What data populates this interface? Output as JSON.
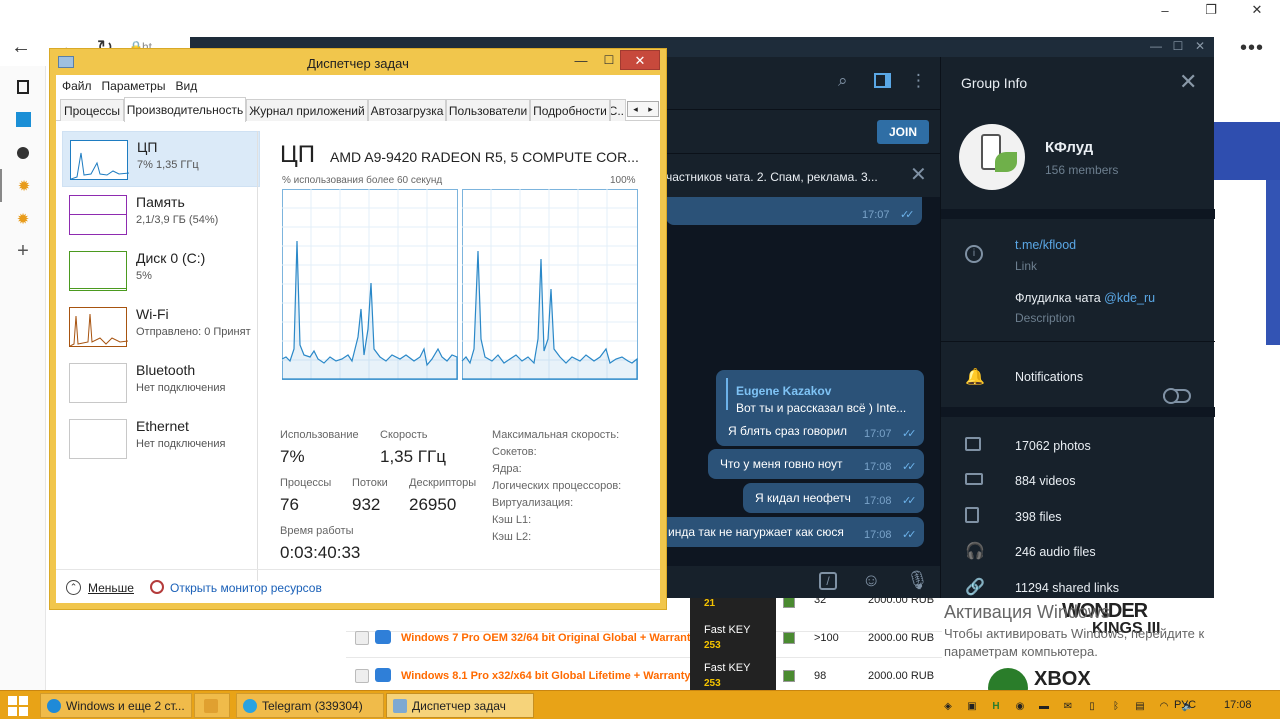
{
  "browser": {
    "tab_text": "ht",
    "window_controls": [
      "–",
      "❐",
      "✕"
    ],
    "more_icon": "•••"
  },
  "web_page": {
    "rows": [
      {
        "product": "",
        "seller": "",
        "seller_num": "21",
        "qty": "32",
        "price": "2000.00 RUB"
      },
      {
        "product": "Windows 7 Pro OEM 32/64 bit Original Global + Warranty",
        "seller": "Fast KEY",
        "seller_num": "253",
        "qty": ">100",
        "price": "2000.00 RUB"
      },
      {
        "product": "Windows 8.1 Pro x32/x64 bit Global Lifetime + Warranty",
        "seller": "Fast KEY",
        "seller_num": "253",
        "qty": "98",
        "price": "2000.00 RUB"
      }
    ],
    "game_banner_1": "WONDER",
    "game_banner_2": "KINGS III",
    "game_banner_3": "XBOX",
    "activation_title": "Активация Windows",
    "activation_text": "Чтобы активировать Windows, перейдите к параметрам компьютера."
  },
  "telegram": {
    "window_controls": [
      "—",
      "☐",
      "✕"
    ],
    "join_label": "JOIN",
    "pinned_text": "частников чата. 2. Спам, реклама. 3...",
    "messages": [
      {
        "text": "",
        "time": "17:07"
      },
      {
        "author": "Eugene Kazakov",
        "quote": "Вот ты и рассказал всё ) Inte...",
        "text": "Я блять сраз говорил",
        "time": "17:07"
      },
      {
        "text": "Что у меня говно ноут",
        "time": "17:08"
      },
      {
        "text": "Я кидал неофетч",
        "time": "17:08"
      },
      {
        "text": "инда так не нагуржает как сюся",
        "time": "17:08"
      }
    ],
    "info": {
      "title": "Group Info",
      "group_name": "КФлуд",
      "members": "156 members",
      "link": "t.me/kflood",
      "link_label": "Link",
      "description_prefix": "Флудилка чата ",
      "description_mention": "@kde_ru",
      "description_label": "Description",
      "notifications_label": "Notifications",
      "notifications_on": false,
      "media": [
        {
          "icon": "photo-icon",
          "label": "17062 photos"
        },
        {
          "icon": "video-icon",
          "label": "884 videos"
        },
        {
          "icon": "file-icon",
          "label": "398 files"
        },
        {
          "icon": "headphones-icon",
          "label": "246 audio files"
        },
        {
          "icon": "link-icon",
          "label": "11294 shared links"
        }
      ]
    }
  },
  "taskmgr": {
    "title": "Диспетчер задач",
    "menu": [
      "Файл",
      "Параметры",
      "Вид"
    ],
    "tabs": [
      "Процессы",
      "Производительность",
      "Журнал приложений",
      "Автозагрузка",
      "Пользователи",
      "Подробности",
      "С..."
    ],
    "active_tab": "Производительность",
    "resources": [
      {
        "name": "ЦП",
        "value": "7% 1,35 ГГц",
        "color": "#1e7cc1"
      },
      {
        "name": "Память",
        "value": "2,1/3,9 ГБ (54%)",
        "color": "#8e2bb0"
      },
      {
        "name": "Диск 0 (C:)",
        "value": "5%",
        "color": "#4b9a1f"
      },
      {
        "name": "Wi-Fi",
        "value": "Отправлено: 0 Принят",
        "color": "#a7530f"
      },
      {
        "name": "Bluetooth",
        "value": "Нет подключения",
        "color": "#c8c8c8"
      },
      {
        "name": "Ethernet",
        "value": "Нет подключения",
        "color": "#c8c8c8"
      }
    ],
    "cpu_title": "ЦП",
    "cpu_model": "AMD A9-9420 RADEON R5, 5 COMPUTE COR...",
    "graph_label": "% использования более 60 секунд",
    "graph_max": "100%",
    "stats": {
      "usage_label": "Использование",
      "usage": "7%",
      "speed_label": "Скорость",
      "speed": "1,35 ГГц",
      "processes_label": "Процессы",
      "processes": "76",
      "threads_label": "Потоки",
      "threads": "932",
      "handles_label": "Дескрипторы",
      "handles": "26950",
      "uptime_label": "Время работы",
      "uptime": "0:03:40:33"
    },
    "specs": [
      "Максимальная скорость:",
      "Сокетов:",
      "Ядра:",
      "Логических процессоров:",
      "Виртуализация:",
      "Кэш L1:",
      "Кэш L2:"
    ],
    "fewer_label": "Меньше",
    "resmon_label": "Открыть монитор ресурсов"
  },
  "taskbar": {
    "buttons": [
      {
        "label": "Windows и еще 2 ст...",
        "color": "#1f8ad8"
      },
      {
        "label": "",
        "color": "#e0a030"
      },
      {
        "label": "Telegram (339304)",
        "color": "#2aa3e0"
      },
      {
        "label": "Диспетчер задач",
        "color": "#7fa9d1"
      }
    ],
    "lang": "РУС",
    "clock": "17:08"
  }
}
